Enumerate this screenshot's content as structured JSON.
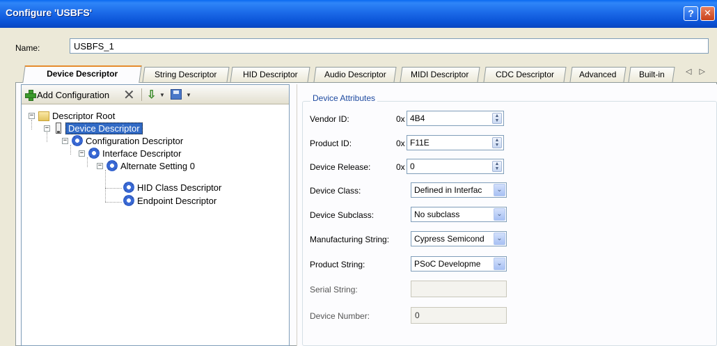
{
  "window": {
    "title": "Configure 'USBFS'",
    "help_glyph": "?",
    "close_glyph": "✕"
  },
  "name": {
    "label": "Name:",
    "value": "USBFS_1"
  },
  "tabs": [
    {
      "label": "Device Descriptor",
      "active": true
    },
    {
      "label": "String Descriptor"
    },
    {
      "label": "HID Descriptor"
    },
    {
      "label": "Audio Descriptor"
    },
    {
      "label": "MIDI Descriptor"
    },
    {
      "label": "CDC Descriptor"
    },
    {
      "label": "Advanced"
    },
    {
      "label": "Built-in"
    }
  ],
  "tab_scroll": "◁ ▷",
  "toolbar": {
    "add_label": "Add Configuration",
    "delete_glyph": "✕",
    "import_glyph": "⇩",
    "dropdown_glyph": "▼"
  },
  "tree": {
    "root": "Descriptor Root",
    "device": "Device Descriptor",
    "configuration": "Configuration Descriptor",
    "interface": "Interface Descriptor",
    "alternate": "Alternate Setting 0",
    "hid_class": "HID Class Descriptor",
    "endpoint": "Endpoint Descriptor",
    "collapse_glyph": "−"
  },
  "attributes": {
    "group_title": "Device Attributes",
    "hex_prefix": "0x",
    "vendor_id": {
      "label": "Vendor ID:",
      "value": "4B4"
    },
    "product_id": {
      "label": "Product ID:",
      "value": "F11E"
    },
    "device_release": {
      "label": "Device Release:",
      "value": "0"
    },
    "device_class": {
      "label": "Device Class:",
      "value": "Defined in Interfac"
    },
    "device_subclass": {
      "label": "Device Subclass:",
      "value": "No subclass"
    },
    "manufacturing_string": {
      "label": "Manufacturing String:",
      "value": "Cypress Semicond"
    },
    "product_string": {
      "label": "Product String:",
      "value": "PSoC Developme"
    },
    "serial_string": {
      "label": "Serial String:",
      "value": ""
    },
    "device_number": {
      "label": "Device Number:",
      "value": "0"
    },
    "spin_glyph": "▲\n▼",
    "combo_glyph": "⌄"
  }
}
